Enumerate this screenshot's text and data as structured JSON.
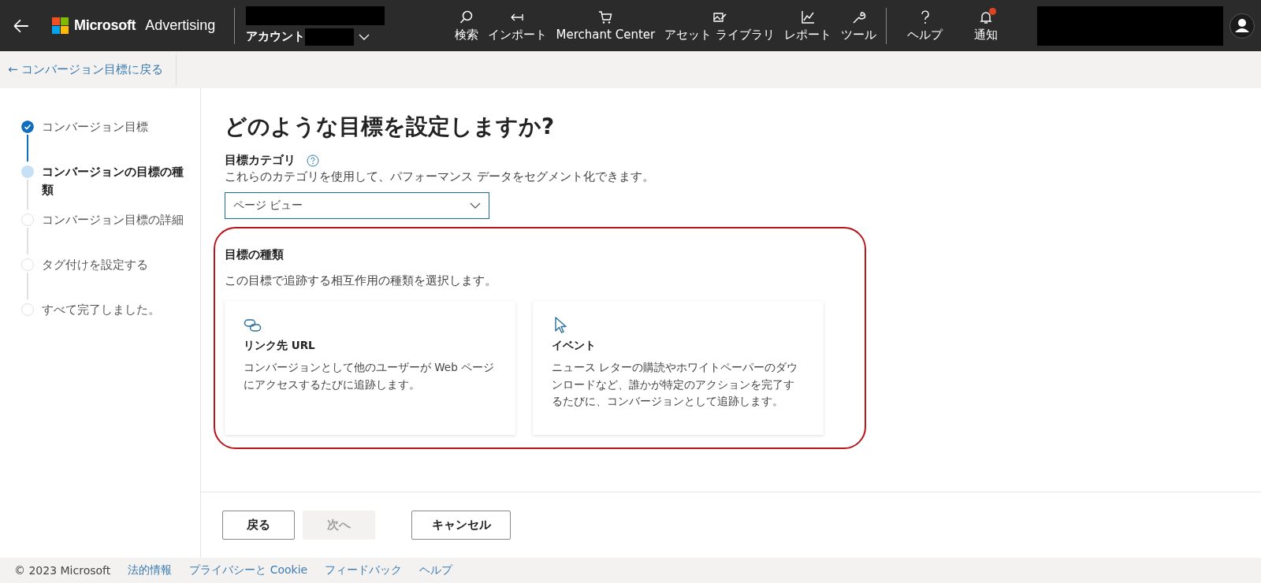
{
  "top_bar": {
    "brand_name": "Microsoft",
    "product_name": "Advertising",
    "account_label": "アカウント",
    "nav": [
      {
        "label": "検索",
        "kind": "search"
      },
      {
        "label": "インポート",
        "kind": "import"
      },
      {
        "label": "Merchant Center",
        "kind": "cart"
      },
      {
        "label": "アセット ライブラリ",
        "kind": "asset"
      },
      {
        "label": "レポート",
        "kind": "chart"
      },
      {
        "label": "ツール",
        "kind": "wrench"
      }
    ],
    "nav_right": [
      {
        "label": "ヘルプ",
        "kind": "help",
        "badge": false
      },
      {
        "label": "通知",
        "kind": "bell",
        "badge": true
      }
    ]
  },
  "sub_bar": {
    "back_link": "← コンバージョン目標に戻る"
  },
  "steps": [
    {
      "label": "コンバージョン目標",
      "kind": "done"
    },
    {
      "label": "コンバージョンの目標の種類",
      "kind": "current"
    },
    {
      "label": "コンバージョン目標の詳細",
      "kind": "pending"
    },
    {
      "label": "タグ付けを設定する",
      "kind": "pending"
    },
    {
      "label": "すべて完了しました。",
      "kind": "pending"
    }
  ],
  "main": {
    "heading": "どのような目標を設定しますか?",
    "category_label": "目標カテゴリ",
    "category_help": "これらのカテゴリを使用して、パフォーマンス データをセグメント化できます。",
    "category_value": "ページ ビュー",
    "goal_type_title": "目標の種類",
    "goal_type_help": "この目標で追跡する相互作用の種類を選択します。",
    "cards": [
      {
        "kind": "link",
        "title": "リンク先 URL",
        "description": "コンバージョンとして他のユーザーが Web ページにアクセスするたびに追跡します。"
      },
      {
        "kind": "event",
        "title": "イベント",
        "description": "ニュース レターの購読やホワイトペーパーのダウンロードなど、誰かが特定のアクションを完了するたびに、コンバージョンとして追跡します。"
      }
    ]
  },
  "actions": [
    {
      "label": "戻る",
      "disabled": false
    },
    {
      "label": "次へ",
      "disabled": true
    },
    {
      "label": "キャンセル",
      "disabled": false
    }
  ],
  "footer": {
    "copyright": "© 2023 Microsoft",
    "links": [
      "法的情報",
      "プライバシーと Cookie",
      "フィードバック",
      "ヘルプ"
    ]
  }
}
